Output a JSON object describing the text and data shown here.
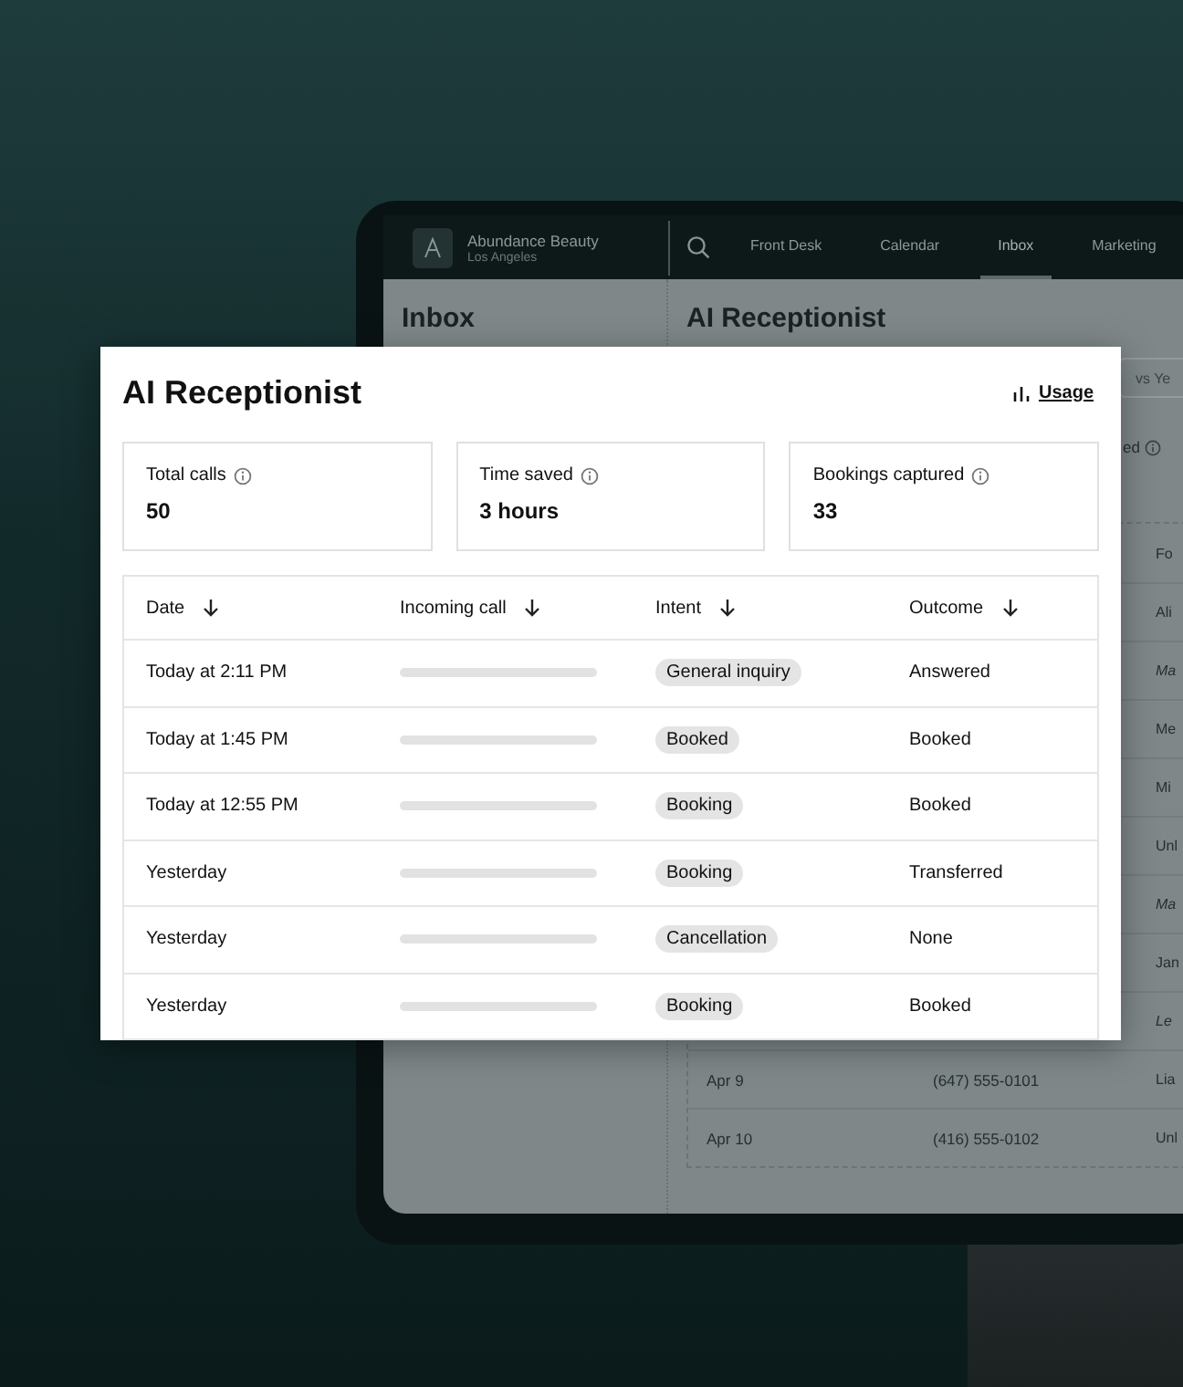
{
  "nav": {
    "business_name": "Abundance Beauty",
    "location": "Los Angeles",
    "tabs": [
      {
        "label": "Front Desk",
        "selected": false
      },
      {
        "label": "Calendar",
        "selected": false
      },
      {
        "label": "Inbox",
        "selected": true
      },
      {
        "label": "Marketing",
        "selected": false
      }
    ]
  },
  "background_screen": {
    "sidebar_title": "Inbox",
    "panel_title": "AI Receptionist",
    "compare_field": "vs Ye",
    "stat_label": "ed",
    "table": {
      "column_3_header": "Fo",
      "rows": [
        {
          "column_3": "Ali",
          "italic": false
        },
        {
          "column_3": "Ma",
          "italic": true
        },
        {
          "column_3": "Me",
          "italic": false
        },
        {
          "column_3": "Mi",
          "italic": false
        },
        {
          "column_3": "Unl",
          "italic": false
        },
        {
          "column_3": "Ma",
          "italic": true
        },
        {
          "column_3": "Jan",
          "italic": false
        },
        {
          "column_3": "Le",
          "italic": true
        },
        {
          "date": "Apr 9",
          "phone": "(647) 555-0101",
          "column_3": "Lia",
          "italic": false
        },
        {
          "date": "Apr 10",
          "phone": "(416) 555-0102",
          "column_3": "Unl",
          "italic": false
        }
      ]
    }
  },
  "card": {
    "title": "AI Receptionist",
    "usage_link": "Usage",
    "stats": [
      {
        "label": "Total calls",
        "value": "50"
      },
      {
        "label": "Time saved",
        "value": "3 hours"
      },
      {
        "label": "Bookings captured",
        "value": "33"
      }
    ],
    "columns": [
      "Date",
      "Incoming call",
      "Intent",
      "Outcome"
    ],
    "rows": [
      {
        "date": "Today at 2:11 PM",
        "intent": "General inquiry",
        "outcome": "Answered"
      },
      {
        "date": "Today at 1:45 PM",
        "intent": "Booked",
        "outcome": "Booked"
      },
      {
        "date": "Today at 12:55 PM",
        "intent": "Booking",
        "outcome": "Booked"
      },
      {
        "date": "Yesterday",
        "intent": "Booking",
        "outcome": "Transferred"
      },
      {
        "date": "Yesterday",
        "intent": "Cancellation",
        "outcome": "None"
      },
      {
        "date": "Yesterday",
        "intent": "Booking",
        "outcome": "Booked"
      }
    ]
  }
}
